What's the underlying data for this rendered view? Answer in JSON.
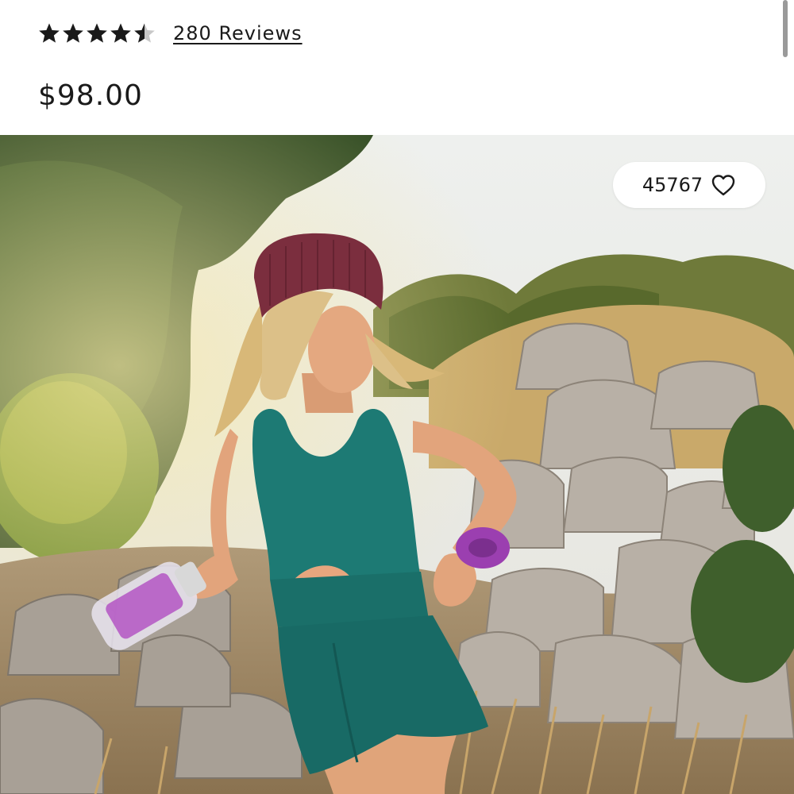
{
  "product": {
    "rating": {
      "value": 4.5,
      "max": 5
    },
    "reviews_label": "280 Reviews",
    "price": "$98.00"
  },
  "hero": {
    "favorites_count": "45767",
    "favorite_icon": "heart-icon"
  },
  "colors": {
    "text": "#1a1a1a",
    "onesie": "#1d7a74",
    "beanie": "#7b2e3e",
    "scrunchie": "#9b3fb0"
  }
}
